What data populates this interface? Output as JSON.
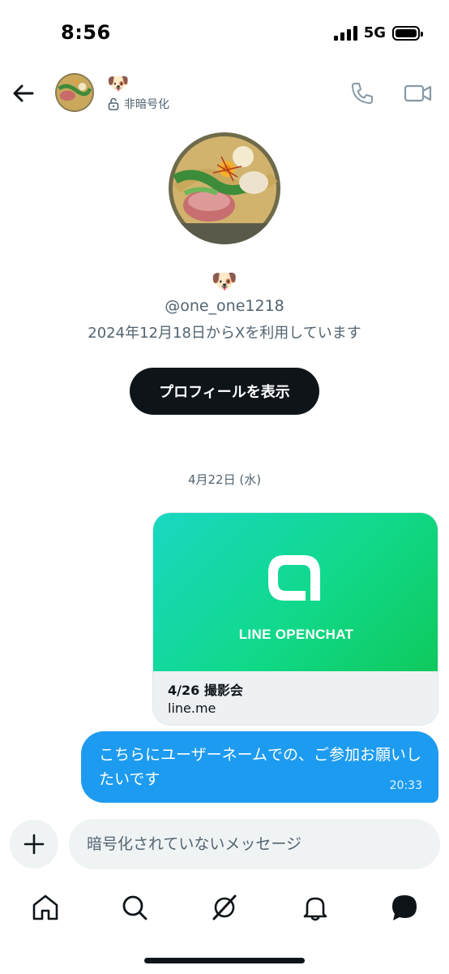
{
  "status_bar": {
    "time": "8:56",
    "network": "5G"
  },
  "header": {
    "display_name": "🐶",
    "encryption_label": "非暗号化"
  },
  "profile": {
    "display_name": "🐶",
    "handle": "@one_one1218",
    "joined": "2024年12月18日からXを利用しています",
    "view_profile_label": "プロフィールを表示"
  },
  "conversation": {
    "date_separator": "4月22日 (水)",
    "link_card": {
      "image_text": "LINE OPENCHAT",
      "title": "4/26 撮影会",
      "domain": "line.me"
    },
    "message": {
      "text": "こちらにユーザーネームでの、ご参加お願いしたいです",
      "time": "20:33"
    }
  },
  "composer": {
    "placeholder": "暗号化されていないメッセージ"
  },
  "bottom_nav": {
    "items": [
      "home-icon",
      "search-icon",
      "grok-icon",
      "notifications-icon",
      "messages-icon"
    ]
  },
  "colors": {
    "accent": "#1d9bf0",
    "dark_button": "#0f1419",
    "secondary_text": "#536471",
    "input_bg": "#eff3f4",
    "openchat_gradient_start": "#18d8c2",
    "openchat_gradient_end": "#0fc95c"
  }
}
